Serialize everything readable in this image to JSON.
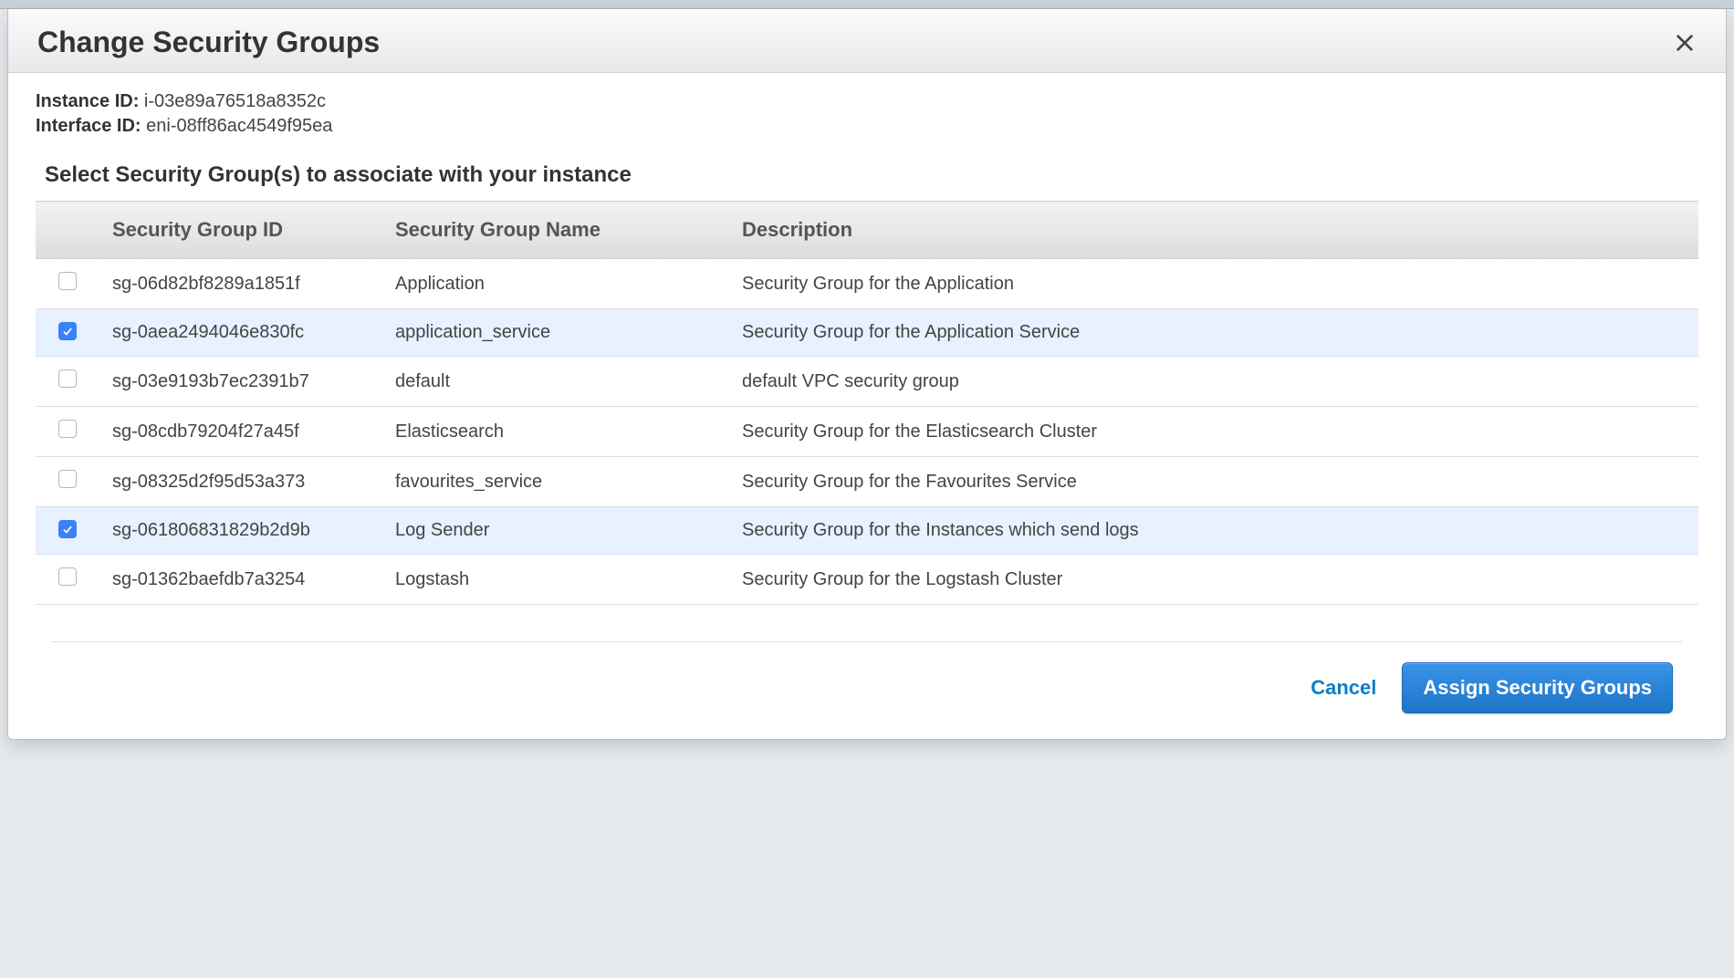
{
  "dialog": {
    "title": "Change Security Groups",
    "instance_label": "Instance ID:",
    "instance_value": "i-03e89a76518a8352c",
    "interface_label": "Interface ID:",
    "interface_value": "eni-08ff86ac4549f95ea",
    "instruction": "Select Security Group(s) to associate with your instance",
    "columns": {
      "id": "Security Group ID",
      "name": "Security Group Name",
      "description": "Description"
    },
    "rows": [
      {
        "checked": false,
        "id": "sg-06d82bf8289a1851f",
        "name": "Application",
        "description": "Security Group for the Application"
      },
      {
        "checked": true,
        "id": "sg-0aea2494046e830fc",
        "name": "application_service",
        "description": "Security Group for the Application Service"
      },
      {
        "checked": false,
        "id": "sg-03e9193b7ec2391b7",
        "name": "default",
        "description": "default VPC security group"
      },
      {
        "checked": false,
        "id": "sg-08cdb79204f27a45f",
        "name": "Elasticsearch",
        "description": "Security Group for the Elasticsearch Cluster"
      },
      {
        "checked": false,
        "id": "sg-08325d2f95d53a373",
        "name": "favourites_service",
        "description": "Security Group for the Favourites Service"
      },
      {
        "checked": true,
        "id": "sg-061806831829b2d9b",
        "name": "Log Sender",
        "description": "Security Group for the Instances which send logs"
      },
      {
        "checked": false,
        "id": "sg-01362baefdb7a3254",
        "name": "Logstash",
        "description": "Security Group for the Logstash Cluster"
      }
    ],
    "footer": {
      "cancel": "Cancel",
      "assign": "Assign Security Groups"
    }
  }
}
